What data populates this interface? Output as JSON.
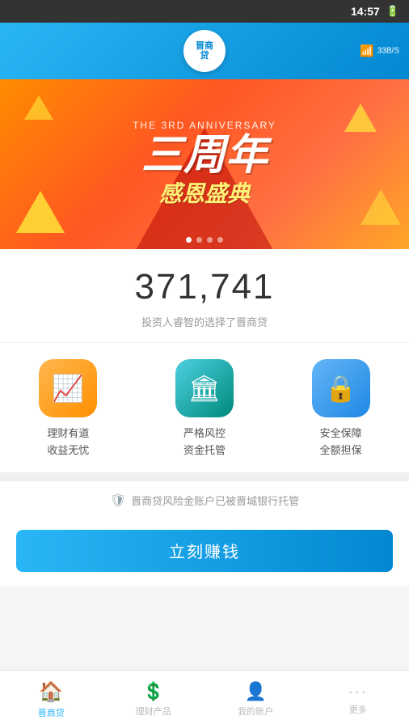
{
  "statusBar": {
    "time": "14:57",
    "batteryIcon": "🔋",
    "wifiSpeed": "33B/S"
  },
  "header": {
    "logoLine1": "晋商",
    "logoLine2": "贷",
    "wifiIcon": "📶"
  },
  "banner": {
    "subtitle": "THE 3RD ANNIVERSARY",
    "titleMain": "三周年",
    "titleSub": "感恩盛典",
    "dots": [
      true,
      false,
      false,
      false
    ]
  },
  "stats": {
    "number": "371,741",
    "description": "投资人睿智的选择了晋商贷"
  },
  "features": [
    {
      "icon": "📈",
      "label1": "理财有道",
      "label2": "收益无忧",
      "colorClass": "orange"
    },
    {
      "icon": "🏦",
      "label1": "严格风控",
      "label2": "资金托管",
      "colorClass": "teal"
    },
    {
      "icon": "🔒",
      "label1": "安全保障",
      "label2": "全额担保",
      "colorClass": "blue"
    }
  ],
  "trust": {
    "shieldIcon": "🛡",
    "text": "晋商贷风险金账户已被晋城银行托管"
  },
  "cta": {
    "buttonLabel": "立刻赚钱"
  },
  "bottomNav": {
    "items": [
      {
        "icon": "🏠",
        "label": "晋商贷",
        "active": true
      },
      {
        "icon": "💲",
        "label": "理财产品",
        "active": false
      },
      {
        "icon": "👤",
        "label": "我的账户",
        "active": false
      },
      {
        "icon": "···",
        "label": "更多",
        "active": false
      }
    ]
  }
}
